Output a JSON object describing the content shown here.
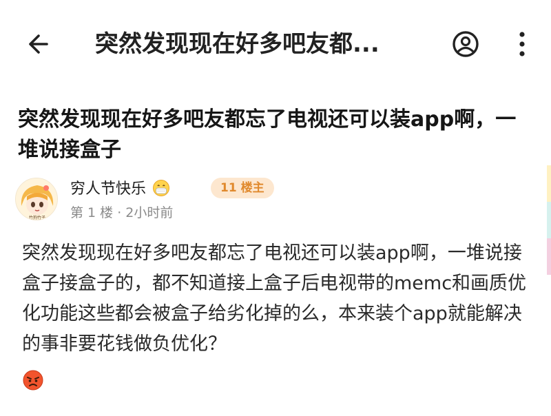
{
  "header": {
    "title": "突然发现现在好多吧友都..."
  },
  "post": {
    "title": "突然发现现在好多吧友都忘了电视还可以装app啊，一堆说接盒子",
    "author": {
      "name": "穷人节快乐",
      "badge": "11 楼主",
      "meta": "第 1 楼 · 2小时前",
      "avatar_caption": "竹狗竹子"
    },
    "body": "突然发现现在好多吧友都忘了电视还可以装app啊，一堆说接盒子接盒子的，都不知道接上盒子后电视带的memc和画质优化功能这些都会被盒子给劣化掉的么，本来装个app就能解决的事非要花钱做负优化？"
  },
  "icons": {
    "back": "arrow-left-icon",
    "user": "user-circle-icon",
    "more": "more-vertical-icon",
    "name_emoji": "mask-face-emoji",
    "body_emoji": "angry-face-emoji"
  },
  "colors": {
    "badge_bg": "#fde7cf",
    "badge_text": "#e0892c",
    "meta": "#8a8a8a",
    "edge": [
      "#fff1c2",
      "#d6f1ee",
      "#f4cfe0"
    ]
  }
}
